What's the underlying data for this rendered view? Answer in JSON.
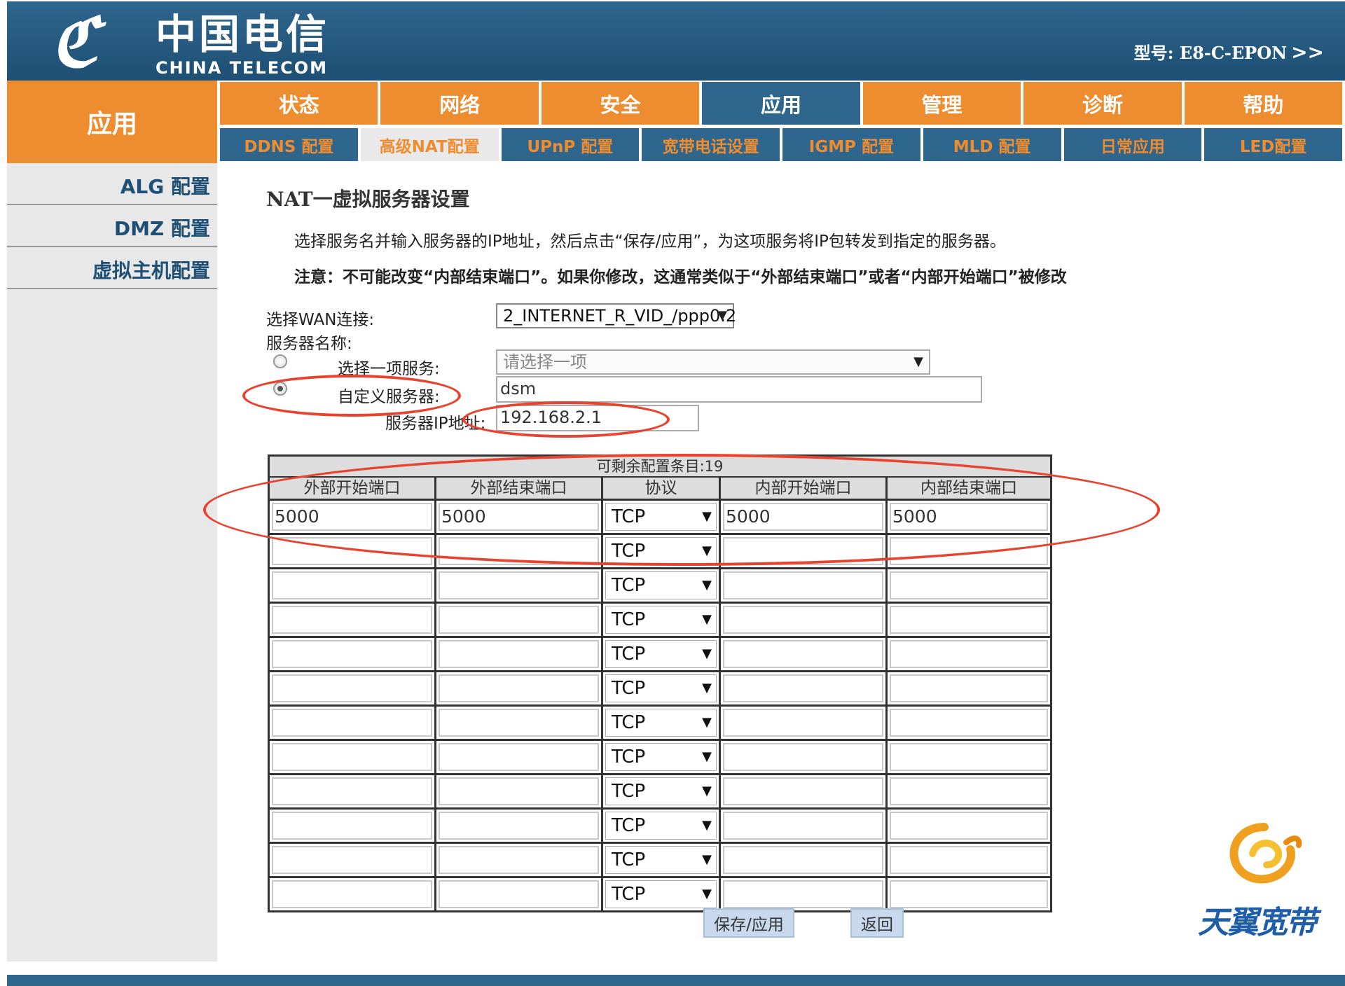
{
  "header": {
    "logo_mark": "ℭ",
    "logo_cn": "中国电信",
    "logo_en": "CHINA TELECOM",
    "model_label": "型号: E8-C-EPON",
    "model_chevron": ">>"
  },
  "section_label": "应用",
  "main_nav": [
    {
      "label": "状态",
      "active": false
    },
    {
      "label": "网络",
      "active": false
    },
    {
      "label": "安全",
      "active": false
    },
    {
      "label": "应用",
      "active": true
    },
    {
      "label": "管理",
      "active": false
    },
    {
      "label": "诊断",
      "active": false
    },
    {
      "label": "帮助",
      "active": false
    }
  ],
  "sub_nav": [
    {
      "label": "DDNS 配置",
      "active": false
    },
    {
      "label": "高级NAT配置",
      "active": true
    },
    {
      "label": "UPnP 配置",
      "active": false
    },
    {
      "label": "宽带电话设置",
      "active": false
    },
    {
      "label": "IGMP 配置",
      "active": false
    },
    {
      "label": "MLD 配置",
      "active": false
    },
    {
      "label": "日常应用",
      "active": false
    },
    {
      "label": "LED配置",
      "active": false
    }
  ],
  "sidebar": {
    "items": [
      "ALG 配置",
      "DMZ 配置",
      "虚拟主机配置"
    ]
  },
  "content": {
    "title": "NAT一虚拟服务器设置",
    "description": "选择服务名并输入服务器的IP地址，然后点击“保存/应用”，为这项服务将IP包转发到指定的服务器。",
    "note": "注意：不可能改变“内部结束端口”。如果你修改，这通常类似于“外部结束端口”或者“内部开始端口”被修改",
    "wan_label": "选择WAN连接:",
    "wan_value": "2_INTERNET_R_VID_/ppp0.2",
    "server_name_label": "服务器名称:",
    "select_service_label": "选择一项服务:",
    "select_service_placeholder": "请选择一项",
    "custom_server_label": "自定义服务器:",
    "custom_server_value": "dsm",
    "server_ip_label": "服务器IP地址:",
    "server_ip_value": "192.168.2.1",
    "selected_mode": "custom"
  },
  "port_table": {
    "remaining": "可剩余配置条目:19",
    "headers": [
      "外部开始端口",
      "外部结束端口",
      "协议",
      "内部开始端口",
      "内部结束端口"
    ],
    "rows": [
      {
        "ext_start": "5000",
        "ext_end": "5000",
        "protocol": "TCP",
        "int_start": "5000",
        "int_end": "5000"
      },
      {
        "ext_start": "",
        "ext_end": "",
        "protocol": "TCP",
        "int_start": "",
        "int_end": ""
      },
      {
        "ext_start": "",
        "ext_end": "",
        "protocol": "TCP",
        "int_start": "",
        "int_end": ""
      },
      {
        "ext_start": "",
        "ext_end": "",
        "protocol": "TCP",
        "int_start": "",
        "int_end": ""
      },
      {
        "ext_start": "",
        "ext_end": "",
        "protocol": "TCP",
        "int_start": "",
        "int_end": ""
      },
      {
        "ext_start": "",
        "ext_end": "",
        "protocol": "TCP",
        "int_start": "",
        "int_end": ""
      },
      {
        "ext_start": "",
        "ext_end": "",
        "protocol": "TCP",
        "int_start": "",
        "int_end": ""
      },
      {
        "ext_start": "",
        "ext_end": "",
        "protocol": "TCP",
        "int_start": "",
        "int_end": ""
      },
      {
        "ext_start": "",
        "ext_end": "",
        "protocol": "TCP",
        "int_start": "",
        "int_end": ""
      },
      {
        "ext_start": "",
        "ext_end": "",
        "protocol": "TCP",
        "int_start": "",
        "int_end": ""
      },
      {
        "ext_start": "",
        "ext_end": "",
        "protocol": "TCP",
        "int_start": "",
        "int_end": ""
      },
      {
        "ext_start": "",
        "ext_end": "",
        "protocol": "TCP",
        "int_start": "",
        "int_end": ""
      }
    ]
  },
  "buttons": {
    "save": "保存/应用",
    "back": "返回"
  },
  "brand": {
    "text": "天翼宽带",
    "icon": "tianyi-swirl-logo"
  },
  "icons": {
    "dropdown": "▼"
  },
  "colors": {
    "header_blue": "#2f668d",
    "nav_orange": "#ee8c30",
    "annotation_red": "#e8432f",
    "brand_blue": "#1e5ea9"
  }
}
